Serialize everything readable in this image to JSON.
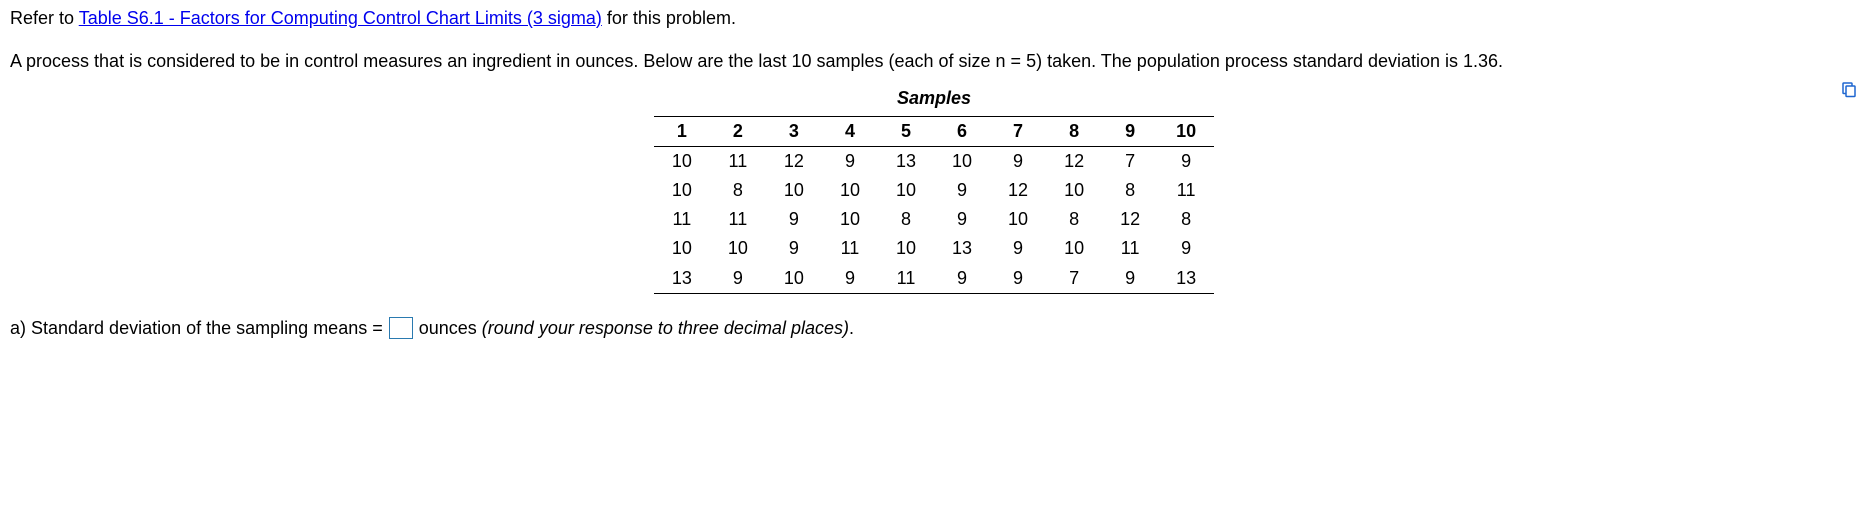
{
  "intro": {
    "prefix": "Refer to ",
    "link_text": "Table S6.1 - Factors for Computing Control Chart Limits (3 sigma)",
    "suffix": " for this problem."
  },
  "problem_text": "A process that is considered to be in control measures an ingredient in ounces. Below are the last 10 samples (each of size n = 5) taken. The population process standard deviation is 1.36.",
  "table": {
    "caption": "Samples",
    "headers": [
      "1",
      "2",
      "3",
      "4",
      "5",
      "6",
      "7",
      "8",
      "9",
      "10"
    ],
    "rows": [
      [
        "10",
        "11",
        "12",
        "9",
        "13",
        "10",
        "9",
        "12",
        "7",
        "9"
      ],
      [
        "10",
        "8",
        "10",
        "10",
        "10",
        "9",
        "12",
        "10",
        "8",
        "11"
      ],
      [
        "11",
        "11",
        "9",
        "10",
        "8",
        "9",
        "10",
        "8",
        "12",
        "8"
      ],
      [
        "10",
        "10",
        "9",
        "11",
        "10",
        "13",
        "9",
        "10",
        "11",
        "9"
      ],
      [
        "13",
        "9",
        "10",
        "9",
        "11",
        "9",
        "9",
        "7",
        "9",
        "13"
      ]
    ]
  },
  "question": {
    "label_prefix": "a) Standard deviation of the sampling means = ",
    "input_value": "",
    "units": " ounces ",
    "hint": "(round your response to three decimal places)",
    "end": "."
  }
}
